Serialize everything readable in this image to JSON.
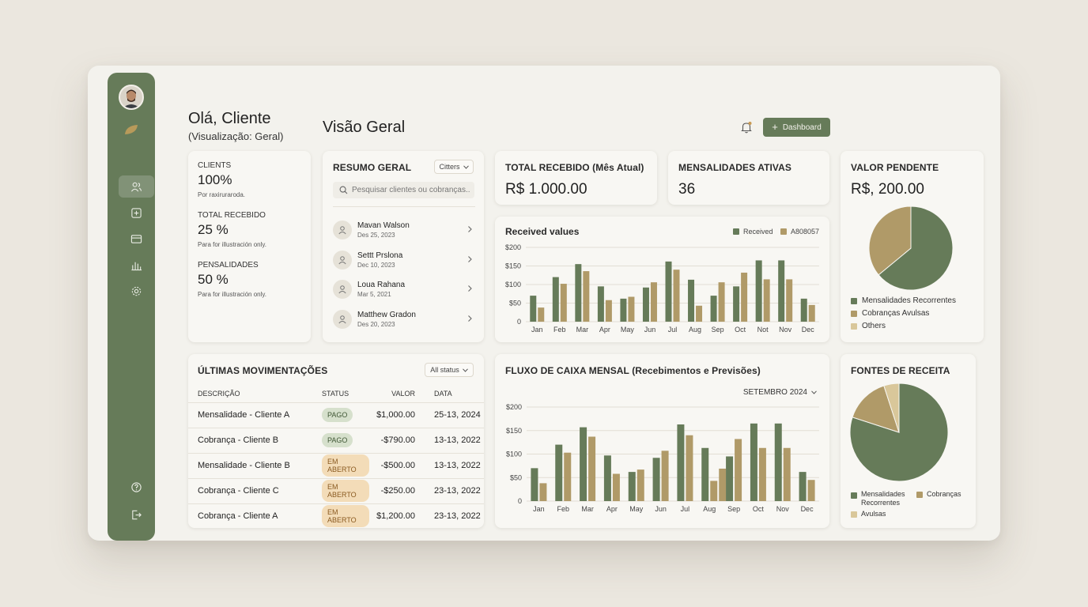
{
  "header": {
    "greeting": "Olá, Cliente",
    "subtitle": "(Visualização: Geral)",
    "page_title": "Visão Geral",
    "dashboard_button": "Dashboard"
  },
  "stats": [
    {
      "label": "CLIENTS",
      "value": "100%",
      "note": "Por raxiruraroda."
    },
    {
      "label": "TOTAL RECEBIDO",
      "value": "25 %",
      "note": "Para for illustración only."
    },
    {
      "label": "PENSALIDADES",
      "value": "50 %",
      "note": "Para for illustración only."
    }
  ],
  "resumo": {
    "title": "RESUMO GERAL",
    "filter": "Citters",
    "search_placeholder": "Pesquisar clientes ou cobranças...",
    "clients": [
      {
        "name": "Mavan Walson",
        "date": "Des 25, 2023"
      },
      {
        "name": "Settt Prslona",
        "date": "Dec 10, 2023"
      },
      {
        "name": "Loua Rahana",
        "date": "Mar 5, 2021"
      },
      {
        "name": "Matthew Gradon",
        "date": "Des 20, 2023"
      }
    ]
  },
  "kpis": {
    "total": {
      "title": "TOTAL RECEBIDO (Mês Atual)",
      "value": "R$ 1.000.00"
    },
    "mensalidades": {
      "title": "MENSALIDADES ATIVAS",
      "value": "36"
    },
    "pendente": {
      "title": "VALOR PENDENTE",
      "value": "R$, 200.00"
    }
  },
  "pendente_legend": [
    "Mensalidades Recorrentes",
    "Cobranças Avulsas",
    "Others"
  ],
  "movimentacoes": {
    "title": "ÚLTIMAS MOVIMENTAÇÕES",
    "filter": "All status",
    "columns": [
      "DESCRIÇÃO",
      "STATUS",
      "VALOR",
      "DATA"
    ],
    "rows": [
      {
        "desc": "Mensalidade - Cliente A",
        "status": "PAGO",
        "kind": "pago",
        "valor": "$1,000.00",
        "data": "25-13, 2024"
      },
      {
        "desc": "Cobrança - Cliente B",
        "status": "PAGO",
        "kind": "pago",
        "valor": "-$790.00",
        "data": "13-13, 2022"
      },
      {
        "desc": "Mensalidade - Cliente B",
        "status": "EM ABERTO",
        "kind": "aberto",
        "valor": "-$500.00",
        "data": "13-13, 2022"
      },
      {
        "desc": "Cobrança - Cliente C",
        "status": "EM ABERTO",
        "kind": "aberto",
        "valor": "-$250.00",
        "data": "23-13, 2022"
      },
      {
        "desc": "Cobrança - Cliente A",
        "status": "EM ABERTO",
        "kind": "aberto",
        "valor": "$1,200.00",
        "data": "23-13, 2022"
      }
    ]
  },
  "fluxo": {
    "title": "FLUXO DE CAIXA MENSAL (Recebimentos e Previsões)",
    "month_select": "SETEMBRO 2024"
  },
  "fontes": {
    "title": "FONTES DE RECEITA",
    "legend": [
      "Mensalidades Recorrentes",
      "Cobranças",
      "Avulsas"
    ]
  },
  "colors": {
    "primary": "#667b59",
    "secondary": "#b09a68",
    "tertiary": "#d9c79a"
  },
  "chart_data": [
    {
      "type": "bar",
      "title": "Received values",
      "categories": [
        "Jan",
        "Feb",
        "Mar",
        "Apr",
        "May",
        "Jun",
        "Jul",
        "Aug",
        "Sep",
        "Oct",
        "Not",
        "Nov",
        "Dec"
      ],
      "series": [
        {
          "name": "Received",
          "values": [
            70,
            120,
            155,
            95,
            62,
            92,
            162,
            113,
            70,
            95,
            165,
            165,
            62
          ]
        },
        {
          "name": "A808057",
          "values": [
            38,
            102,
            136,
            58,
            67,
            106,
            140,
            43,
            106,
            132,
            114,
            114,
            45
          ]
        }
      ],
      "yticks": [
        "$200",
        "$150",
        "$100",
        "$50",
        "0"
      ],
      "ylim": [
        0,
        200
      ],
      "legend": "top-right"
    },
    {
      "type": "bar",
      "title": "FLUXO DE CAIXA MENSAL (Recebimentos e Previsões)",
      "categories": [
        "Jan",
        "Feb",
        "Mar",
        "Apr",
        "May",
        "Jun",
        "Jul",
        "Aug",
        "Sep",
        "Oct",
        "Nov",
        "Dec"
      ],
      "series": [
        {
          "values": [
            70,
            120,
            157,
            97,
            62,
            92,
            163,
            113,
            95,
            165,
            165,
            62
          ]
        },
        {
          "values": [
            38,
            103,
            137,
            58,
            67,
            107,
            140,
            43,
            132,
            113,
            113,
            45
          ]
        }
      ],
      "extra_bar": {
        "category": "Aug",
        "value": 69
      },
      "yticks": [
        "$200",
        "$150",
        "$100",
        "$50",
        "0"
      ],
      "ylim": [
        0,
        200
      ]
    },
    {
      "type": "pie",
      "title": "VALOR PENDENTE",
      "labels": [
        "Mensalidades Recorrentes",
        "Cobranças Avulsas"
      ],
      "values": [
        64,
        36
      ]
    },
    {
      "type": "pie",
      "title": "FONTES DE RECEITA",
      "labels": [
        "Mensalidades Recorrentes",
        "Cobranças",
        "Avulsas"
      ],
      "values": [
        80,
        15,
        5
      ]
    }
  ]
}
